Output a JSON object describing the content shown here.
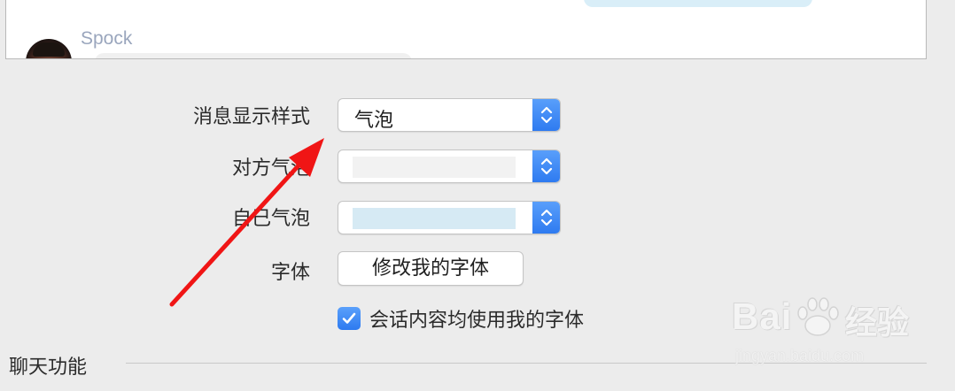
{
  "preview": {
    "sender_name": "Spock"
  },
  "settings": {
    "message_style": {
      "label": "消息显示样式",
      "value": "气泡"
    },
    "other_bubble": {
      "label": "对方气泡",
      "color": "#f2f2f2"
    },
    "self_bubble": {
      "label": "自己气泡",
      "color": "#d6eaf4"
    },
    "font": {
      "label": "字体",
      "button_label": "修改我的字体"
    },
    "use_my_font": {
      "label": "会话内容均使用我的字体",
      "checked": true
    }
  },
  "section": {
    "title": "聊天功能"
  },
  "watermark": {
    "logo": "Bai",
    "logo_brand": "经验",
    "url": "jingyan.baidu.com"
  },
  "colors": {
    "accent": "#2d7af0",
    "annotation": "#f01515"
  },
  "icons": {
    "popup_stepper": "up-down-chevron-icon",
    "checkbox": "checkmark-icon",
    "avatar": "user-avatar"
  }
}
